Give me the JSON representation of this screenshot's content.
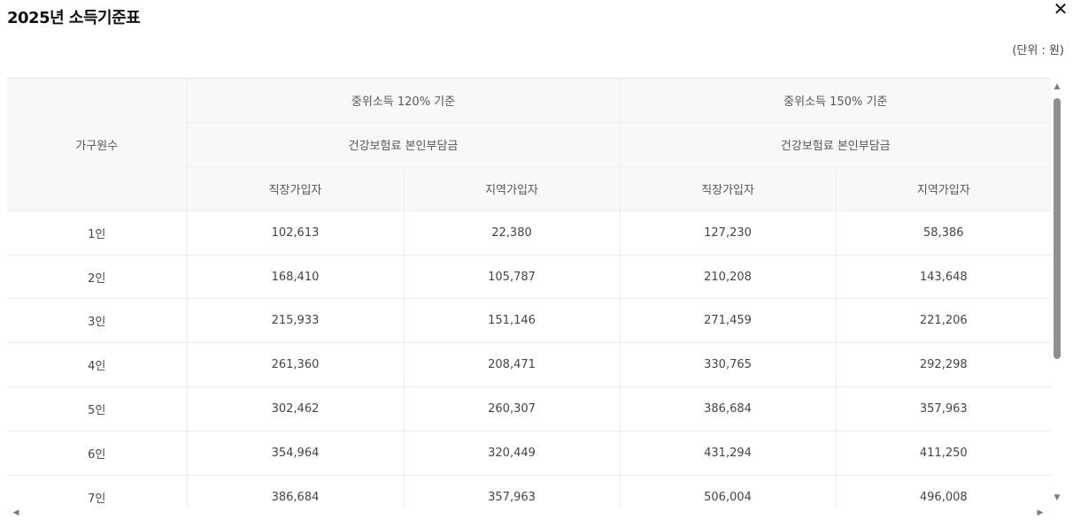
{
  "modal": {
    "title": "2025년 소득기준표",
    "close_symbol": "✕",
    "unit_note": "(단위 : 원)"
  },
  "table": {
    "header": {
      "household": "가구원수",
      "group_120": "중위소득 120% 기준",
      "group_150": "중위소득 150% 기준",
      "sub_120": "건강보험료 본인부담금",
      "sub_150": "건강보험료 본인부담금",
      "employee_120": "직장가입자",
      "regional_120": "지역가입자",
      "employee_150": "직장가입자",
      "regional_150": "지역가입자"
    },
    "rows": [
      {
        "household": "1인",
        "employee_120": "102,613",
        "regional_120": "22,380",
        "employee_150": "127,230",
        "regional_150": "58,386"
      },
      {
        "household": "2인",
        "employee_120": "168,410",
        "regional_120": "105,787",
        "employee_150": "210,208",
        "regional_150": "143,648"
      },
      {
        "household": "3인",
        "employee_120": "215,933",
        "regional_120": "151,146",
        "employee_150": "271,459",
        "regional_150": "221,206"
      },
      {
        "household": "4인",
        "employee_120": "261,360",
        "regional_120": "208,471",
        "employee_150": "330,765",
        "regional_150": "292,298"
      },
      {
        "household": "5인",
        "employee_120": "302,462",
        "regional_120": "260,307",
        "employee_150": "386,684",
        "regional_150": "357,963"
      },
      {
        "household": "6인",
        "employee_120": "354,964",
        "regional_120": "320,449",
        "employee_150": "431,294",
        "regional_150": "411,250"
      },
      {
        "household": "7인",
        "employee_120": "386,684",
        "regional_120": "357,963",
        "employee_150": "506,004",
        "regional_150": "496,008"
      }
    ]
  },
  "scrollbars": {
    "up_arrow": "▲",
    "down_arrow": "▼",
    "left_arrow": "◀",
    "right_arrow": "▶"
  }
}
